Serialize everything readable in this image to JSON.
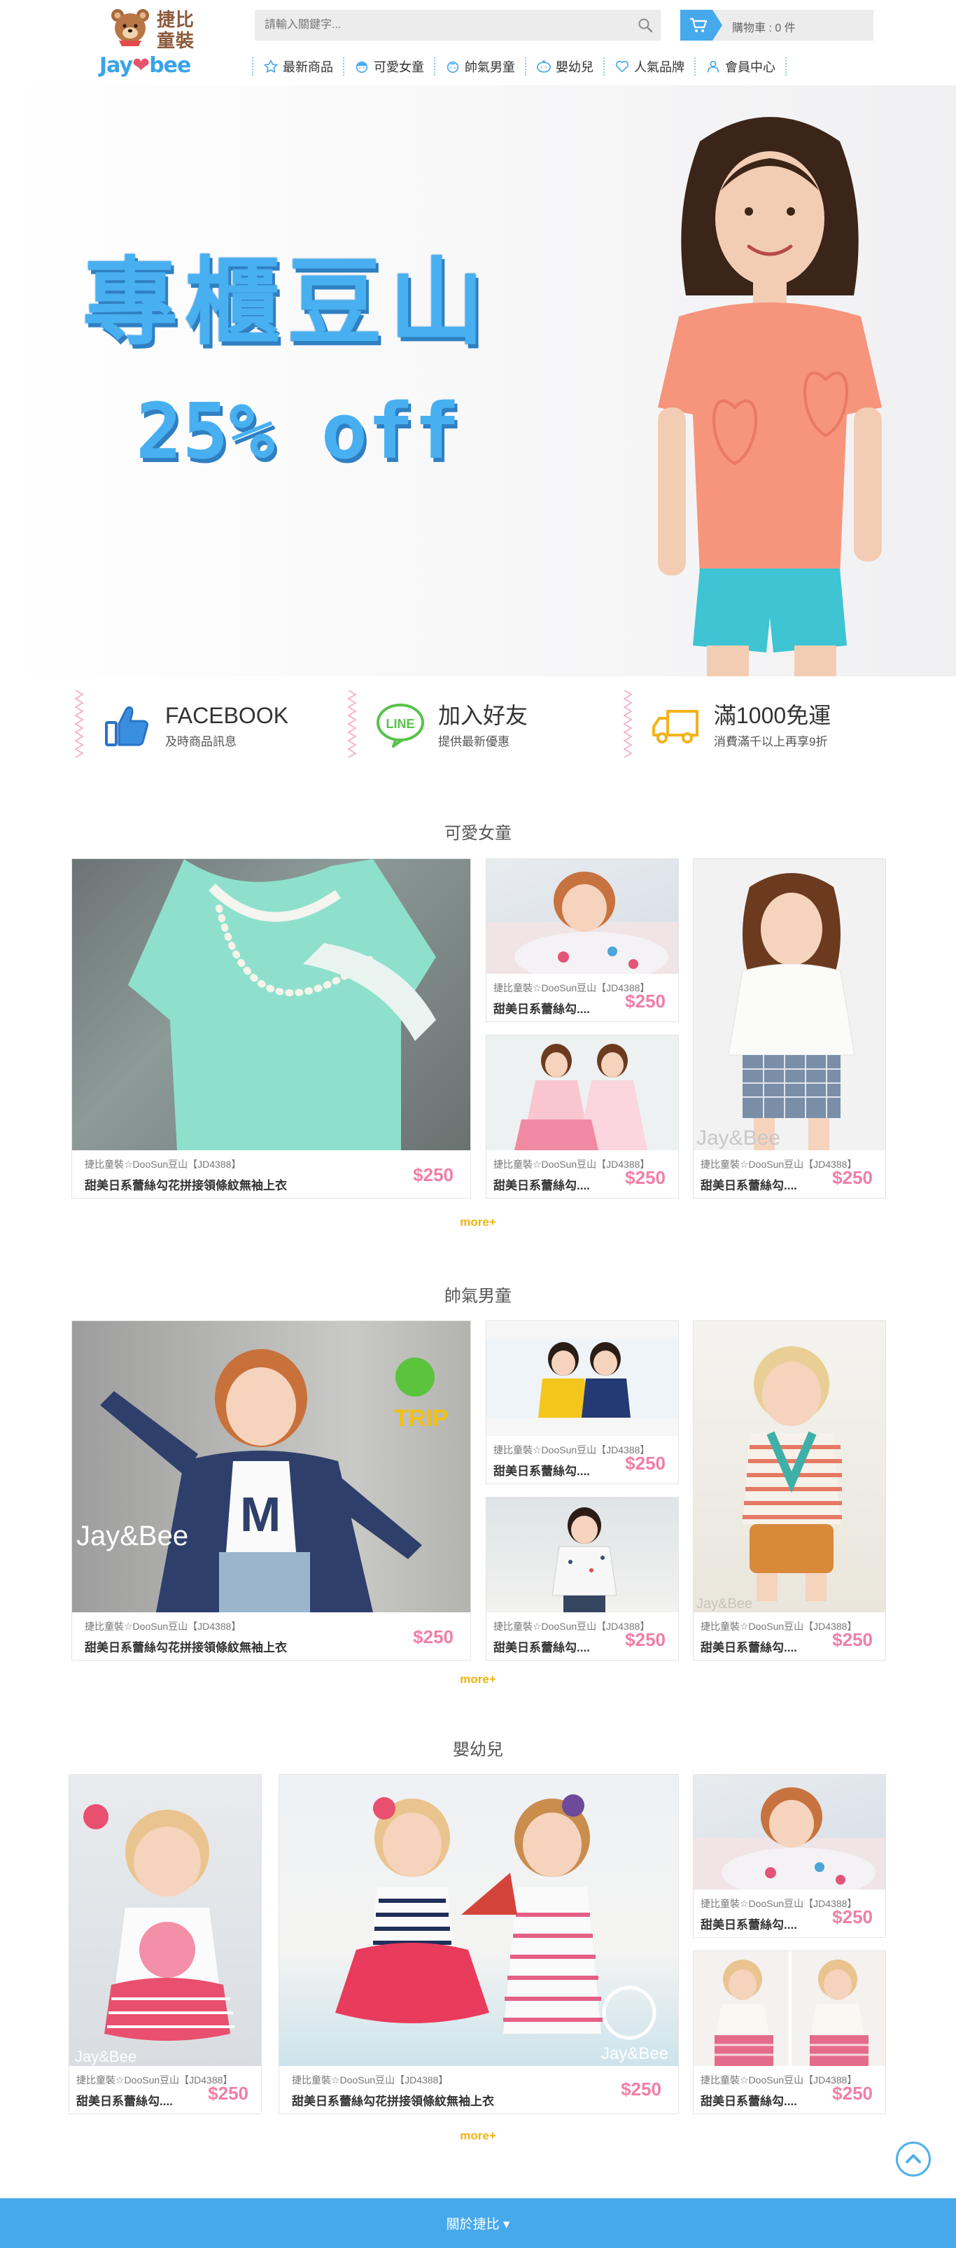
{
  "header": {
    "logo_cn": "捷比童裝",
    "logo_en_left": "Jay",
    "logo_en_right": "bee",
    "search_placeholder": "請輸入關鍵字...",
    "cart_text": "購物車 : 0 件"
  },
  "nav": [
    {
      "label": "最新商品",
      "icon": "star-icon"
    },
    {
      "label": "可愛女童",
      "icon": "girl-face-icon"
    },
    {
      "label": "帥氣男童",
      "icon": "boy-face-icon"
    },
    {
      "label": "嬰幼兒",
      "icon": "baby-face-icon"
    },
    {
      "label": "人氣品牌",
      "icon": "heart-icon"
    },
    {
      "label": "會員中心",
      "icon": "user-icon"
    }
  ],
  "banner": {
    "title": "專櫃豆山",
    "subtitle": "25% off"
  },
  "features": [
    {
      "title": "FACEBOOK",
      "sub": "及時商品訊息",
      "icon": "thumbs-up-icon"
    },
    {
      "title": "加入好友",
      "sub": "提供最新優惠",
      "icon": "line-icon"
    },
    {
      "title": "滿1000免運",
      "sub": "消費滿千以上再享9折",
      "icon": "truck-icon"
    }
  ],
  "sections": [
    {
      "title": "可愛女童",
      "more": "more+",
      "products": [
        {
          "brand": "捷比童裝☆DooSun豆山【JD4388】",
          "name": "甜美日系蕾絲勾花拼接領條紋無袖上衣",
          "price": "$250"
        },
        {
          "brand": "捷比童裝☆DooSun豆山【JD4388】",
          "name": "甜美日系蕾絲勾....",
          "price": "$250"
        },
        {
          "brand": "捷比童裝☆DooSun豆山【JD4388】",
          "name": "甜美日系蕾絲勾....",
          "price": "$250"
        },
        {
          "brand": "捷比童裝☆DooSun豆山【JD4388】",
          "name": "甜美日系蕾絲勾....",
          "price": "$250"
        }
      ]
    },
    {
      "title": "帥氣男童",
      "more": "more+",
      "products": [
        {
          "brand": "捷比童裝☆DooSun豆山【JD4388】",
          "name": "甜美日系蕾絲勾花拼接領條紋無袖上衣",
          "price": "$250"
        },
        {
          "brand": "捷比童裝☆DooSun豆山【JD4388】",
          "name": "甜美日系蕾絲勾....",
          "price": "$250"
        },
        {
          "brand": "捷比童裝☆DooSun豆山【JD4388】",
          "name": "甜美日系蕾絲勾....",
          "price": "$250"
        },
        {
          "brand": "捷比童裝☆DooSun豆山【JD4388】",
          "name": "甜美日系蕾絲勾....",
          "price": "$250"
        }
      ]
    },
    {
      "title": "嬰幼兒",
      "more": "more+",
      "products": [
        {
          "brand": "捷比童裝☆DooSun豆山【JD4388】",
          "name": "甜美日系蕾絲勾....",
          "price": "$250"
        },
        {
          "brand": "捷比童裝☆DooSun豆山【JD4388】",
          "name": "甜美日系蕾絲勾花拼接領條紋無袖上衣",
          "price": "$250"
        },
        {
          "brand": "捷比童裝☆DooSun豆山【JD4388】",
          "name": "甜美日系蕾絲勾....",
          "price": "$250"
        },
        {
          "brand": "捷比童裝☆DooSun豆山【JD4388】",
          "name": "甜美日系蕾絲勾....",
          "price": "$250"
        }
      ]
    }
  ],
  "image_overlays": {
    "watermark": "Jay&Bee",
    "trip": "TRIP"
  },
  "footer": {
    "label": "關於捷比 ▾"
  },
  "colors": {
    "accent_blue": "#46a9ec",
    "price_pink": "#f17fa6",
    "more_gold": "#f0b40d"
  }
}
